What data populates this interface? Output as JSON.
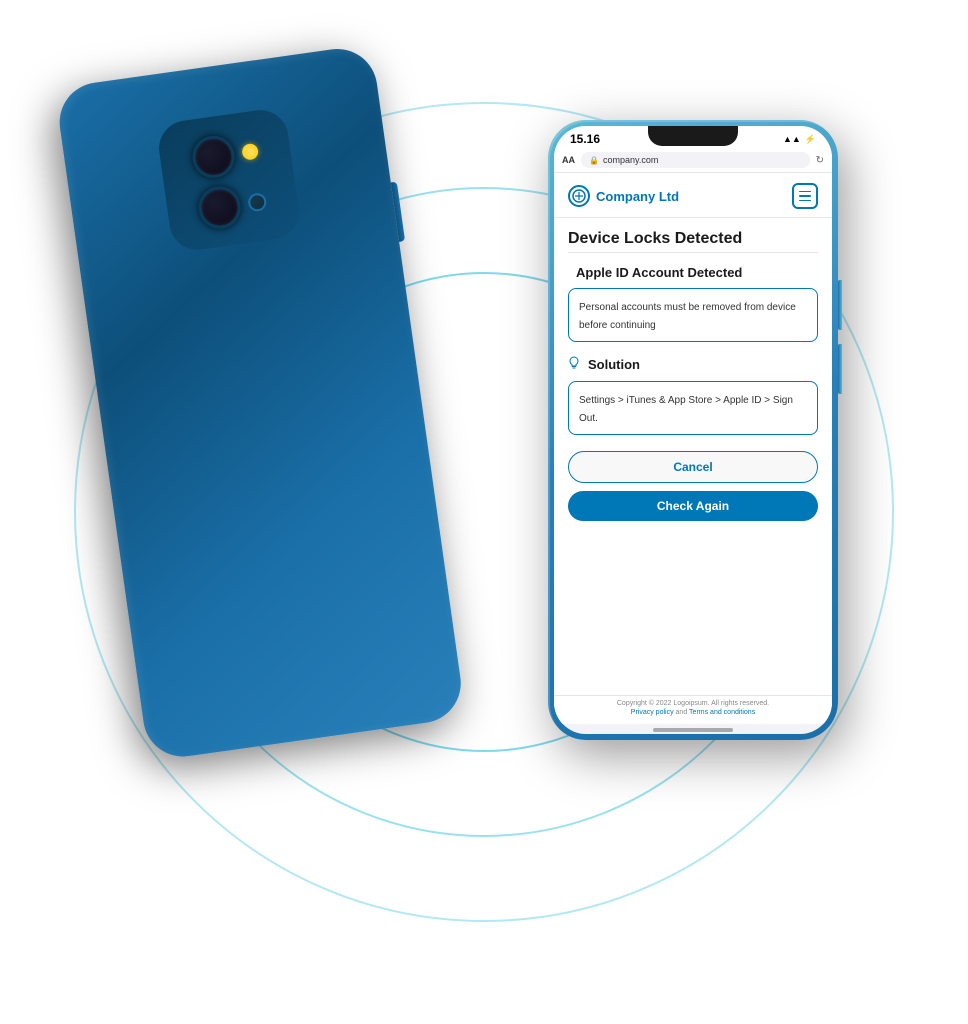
{
  "scene": {
    "background": "#ffffff"
  },
  "status_bar": {
    "time": "15.16",
    "wifi": "wifi",
    "battery": "⚡"
  },
  "browser": {
    "aa_label": "AA",
    "url": "company.com",
    "lock_icon": "🔒",
    "reload_icon": "↻"
  },
  "company": {
    "name": "Company Ltd",
    "logo_text": "⊙",
    "menu_icon": "menu"
  },
  "page": {
    "title": "Device Locks Detected",
    "alert_title": "Apple ID Account Detected",
    "alert_message": "Personal accounts must be removed from device before continuing",
    "solution_title": "Solution",
    "solution_text": "Settings > iTunes & App Store > Apple ID > Sign Out.",
    "cancel_button": "Cancel",
    "check_button": "Check Again"
  },
  "footer": {
    "copyright": "Copyright © 2022 Logoipsum. All rights reserved.",
    "privacy_policy": "Privacy policy",
    "and_text": "and",
    "terms": "Terms and conditions"
  }
}
